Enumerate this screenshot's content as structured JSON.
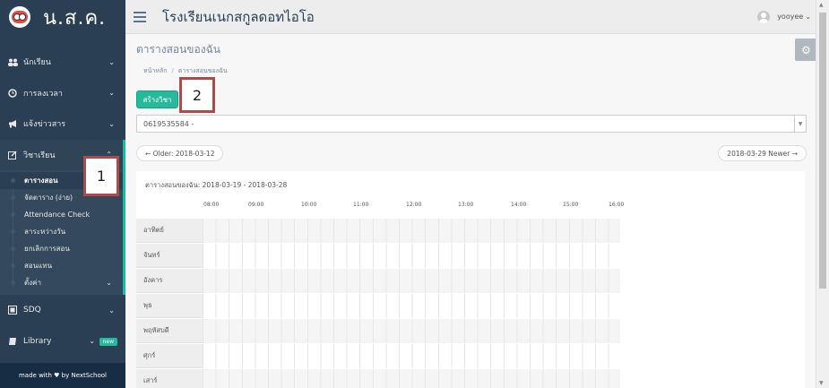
{
  "brand": {
    "name": "น.ส.ค."
  },
  "header": {
    "school_name": "โรงเรียนเนกสกูลดอทไอโอ",
    "username": "yooyee"
  },
  "sidebar": {
    "menu": [
      {
        "label": "นักเรียน",
        "icon": "users-icon"
      },
      {
        "label": "การลงเวลา",
        "icon": "clock-icon"
      },
      {
        "label": "แจ้งข่าวสาร",
        "icon": "bullhorn-icon"
      },
      {
        "label": "วิชาเรียน",
        "icon": "edit-icon"
      }
    ],
    "submenu": [
      {
        "label": "ตารางสอน"
      },
      {
        "label": "จัดตาราง (ง่าย)"
      },
      {
        "label": "Attendance Check"
      },
      {
        "label": "ลาระหว่างวัน"
      },
      {
        "label": "ยกเลิกการสอน"
      },
      {
        "label": "สอนแทน"
      },
      {
        "label": "ตั้งค่า"
      }
    ],
    "menu_bottom": [
      {
        "label": "SDQ",
        "icon": "sdq-icon"
      },
      {
        "label": "Library",
        "icon": "book-icon",
        "badge": "new"
      }
    ],
    "footer": "made with ♥ by NextSchool"
  },
  "main": {
    "page_title": "ตารางสอนของฉัน",
    "breadcrumb": [
      "หน้าหลัก",
      "ตารางสอนของฉัน"
    ],
    "create_button": "สร้างวิชา",
    "teacher_select_value": "0619535584 -",
    "pager_older": "← Older: 2018-03-12",
    "pager_newer": "2018-03-29 Newer →"
  },
  "timetable": {
    "caption": "ตารางสอนของฉัน: 2018-03-19 - 2018-03-28",
    "times": [
      "08:00",
      "09:00",
      "10:00",
      "11:00",
      "12:00",
      "13:00",
      "14:00",
      "15:00",
      "16:00"
    ],
    "days": [
      "อาทิตย์",
      "จันทร์",
      "อังคาร",
      "พุธ",
      "พฤหัสบดี",
      "ศุกร์",
      "เสาร์"
    ]
  },
  "annotations": [
    "1",
    "2"
  ]
}
